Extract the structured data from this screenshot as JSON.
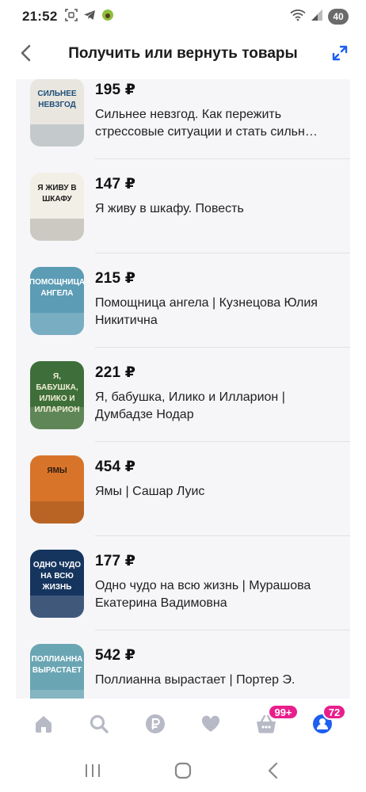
{
  "status_bar": {
    "time": "21:52",
    "battery": "40",
    "left_icons": [
      "screenshot-icon",
      "telegram-icon",
      "avocado-app-icon"
    ],
    "right_icons": [
      "wifi-icon",
      "signal-icon"
    ]
  },
  "header": {
    "title": "Получить или вернуть товары"
  },
  "products": [
    {
      "price": "195 ₽",
      "title": "Сильнее невзгод. Как пережить стрессовые ситуации и стать сильн…",
      "cover_text": "СИЛЬНЕЕ НЕВЗГОД",
      "cover_bg": "#e8e6df",
      "cover_fg": "#1f4f78"
    },
    {
      "price": "147 ₽",
      "title": "Я живу в шкафу. Повесть",
      "cover_text": "Я ЖИВУ В ШКАФУ",
      "cover_bg": "#f2efe6",
      "cover_fg": "#1c1c1c"
    },
    {
      "price": "215 ₽",
      "title": "Помощница ангела | Кузнецова Юлия Никитична",
      "cover_text": "ПОМОЩНИЦА АНГЕЛА",
      "cover_bg": "#5c9cb5",
      "cover_fg": "#ffffff"
    },
    {
      "price": "221 ₽",
      "title": "Я, бабушка, Илико и Илларион | Думбадзе Нодар",
      "cover_text": "Я, БАБУШКА, ИЛИКО И ИЛЛАРИОН",
      "cover_bg": "#3e6f3a",
      "cover_fg": "#f3eed7"
    },
    {
      "price": "454 ₽",
      "title": "Ямы | Сашар Луис",
      "cover_text": "ЯМЫ",
      "cover_bg": "#d8742a",
      "cover_fg": "#2a1b10"
    },
    {
      "price": "177 ₽",
      "title": "Одно чудо на всю жизнь | Мурашова Екатерина Вадимовна",
      "cover_text": "ОДНО ЧУДО НА ВСЮ ЖИЗНЬ",
      "cover_bg": "#16355e",
      "cover_fg": "#ffffff"
    },
    {
      "price": "542 ₽",
      "title": "Поллианна вырастает | Портер Э.",
      "cover_text": "ПОЛЛИАННА ВЫРАСТАЕТ",
      "cover_bg": "#6aa5b3",
      "cover_fg": "#ffffff"
    }
  ],
  "tabbar": {
    "items": [
      {
        "name": "home",
        "icon": "home-icon"
      },
      {
        "name": "search",
        "icon": "search-icon"
      },
      {
        "name": "payments",
        "icon": "ruble-icon"
      },
      {
        "name": "favorites",
        "icon": "heart-icon"
      },
      {
        "name": "cart",
        "icon": "basket-icon",
        "badge": "99+"
      },
      {
        "name": "profile",
        "icon": "profile-icon",
        "badge": "72"
      }
    ]
  },
  "colors": {
    "accent": "#1e5ff0",
    "badge": "#e91e8c",
    "icon_gray": "#b7bac6",
    "list_bg": "#f6f6f9"
  }
}
